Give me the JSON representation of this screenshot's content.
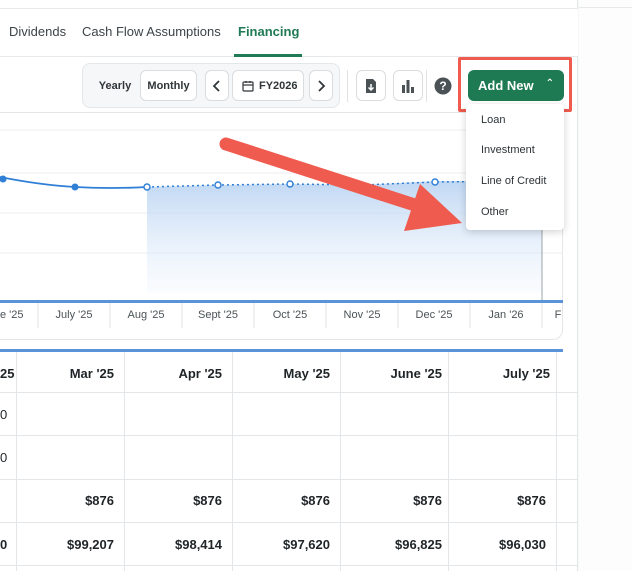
{
  "tabs": [
    {
      "label": "Dividends"
    },
    {
      "label": "Cash Flow Assumptions"
    },
    {
      "label": "Financing",
      "active": true
    }
  ],
  "toolbar": {
    "yearly": "Yearly",
    "monthly": "Monthly",
    "fiscal_year": "FY2026",
    "add_new": "Add New"
  },
  "dropdown": {
    "items": [
      "Loan",
      "Investment",
      "Line of Credit",
      "Other"
    ]
  },
  "colors": {
    "brand_green": "#1e7a52",
    "line_blue": "#2f7fd6",
    "highlight_red": "#ef5b4e"
  },
  "chart_data": {
    "type": "line",
    "x_labels": [
      "e '25",
      "July '25",
      "Aug '25",
      "Sept '25",
      "Oct '25",
      "Nov '25",
      "Dec '25",
      "Jan '26",
      "F"
    ],
    "series": [
      {
        "values_relative": [
          0.62,
          0.67,
          0.67,
          0.67,
          0.67,
          0.67,
          0.67,
          0.66,
          0.65
        ],
        "actual_until_index": 2,
        "forecast_fill": true
      }
    ]
  },
  "table": {
    "headers": [
      "25",
      "Mar '25",
      "Apr '25",
      "May '25",
      "June '25",
      "July '25"
    ],
    "rows": [
      [
        "0",
        "",
        "",
        "",
        "",
        ""
      ],
      [
        "0",
        "",
        "",
        "",
        "",
        ""
      ],
      [
        "",
        "$876",
        "$876",
        "$876",
        "$876",
        "$876"
      ],
      [
        "0",
        "$99,207",
        "$98,414",
        "$97,620",
        "$96,825",
        "$96,030"
      ]
    ]
  }
}
